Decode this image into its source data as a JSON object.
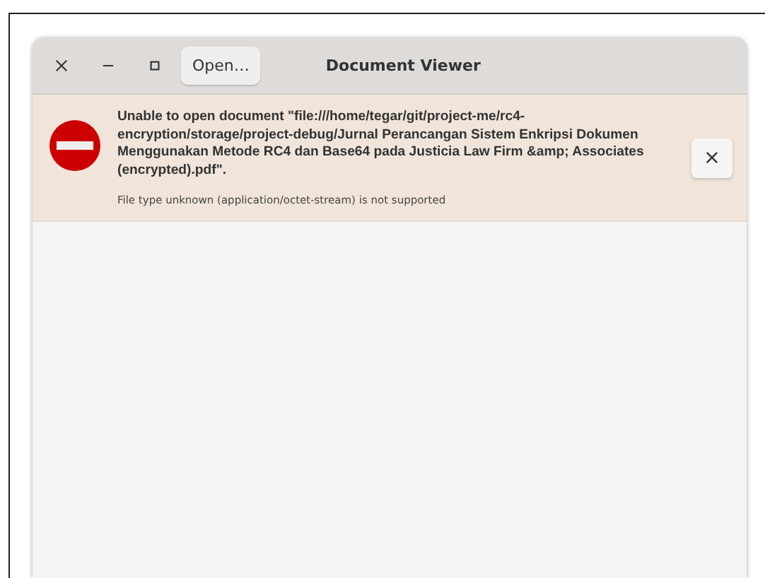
{
  "window": {
    "title": "Document Viewer"
  },
  "header_buttons": [
    {
      "kind": "close"
    },
    {
      "kind": "minimize"
    },
    {
      "kind": "maximize"
    }
  ],
  "open_button": {
    "label": "Open…"
  },
  "error_bar": {
    "message": "Unable to open document \"file:///home/tegar/git/project-me/rc4-encryption/storage/project-debug/Jurnal Perancangan Sistem Enkripsi Dokumen Menggunakan Metode RC4 dan Base64 pada Justicia Law Firm &amp; Associates (encrypted).pdf\".",
    "detail": "File type unknown (application/octet-stream) is not supported"
  }
}
